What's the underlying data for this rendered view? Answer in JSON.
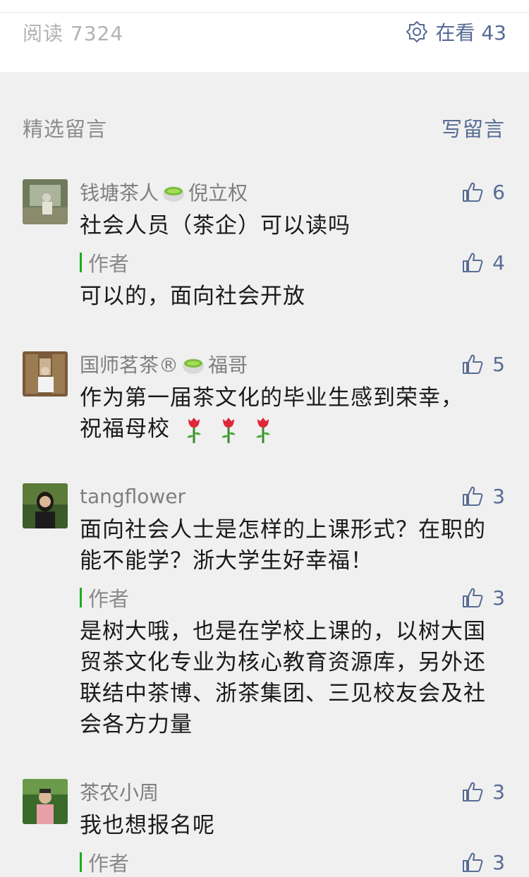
{
  "stats": {
    "read_label": "阅读 7324",
    "watching_label": "在看 43"
  },
  "section": {
    "title": "精选留言",
    "write_label": "写留言"
  },
  "comments": [
    {
      "nick_part1": "钱塘茶人",
      "nick_part2": "倪立权",
      "likes": "6",
      "text": "社会人员（茶企）可以读吗",
      "reply": {
        "label": "作者",
        "likes": "4",
        "text": "可以的，面向社会开放"
      }
    },
    {
      "nick_part1": "国师茗茶®",
      "nick_part2": "福哥",
      "likes": "5",
      "text": "作为第一届茶文化的毕业生感到荣幸，",
      "text_line2": "祝福母校"
    },
    {
      "nick_part1": "tangflower",
      "likes": "3",
      "text": "面向社会人士是怎样的上课形式？在职的能不能学？浙大学生好幸福！",
      "reply": {
        "label": "作者",
        "likes": "3",
        "text": "是树大哦，也是在学校上课的，以树大国贸茶文化专业为核心教育资源库，另外还联结中茶博、浙茶集团、三见校友会及社会各方力量"
      }
    },
    {
      "nick_part1": "茶农小周",
      "likes": "3",
      "text": "我也想报名呢",
      "reply": {
        "label": "作者",
        "likes": "3"
      }
    }
  ],
  "icons": {
    "watching": "watching-star-icon",
    "like": "thumbs-up-icon",
    "emoji_tea": "teacup-emoji",
    "emoji_rose": "rose-emoji"
  },
  "colors": {
    "link": "#576b95",
    "author_bar": "#1aad19",
    "meta_text": "#b2b2b2"
  }
}
